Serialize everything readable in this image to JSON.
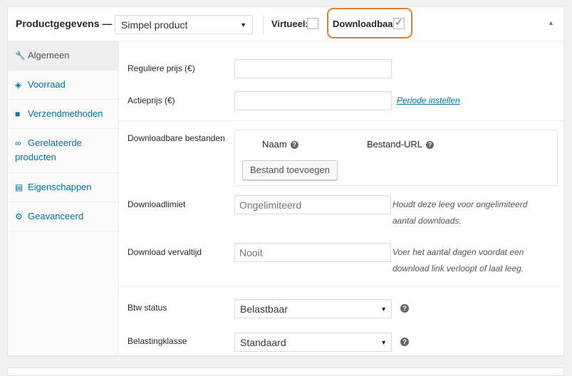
{
  "header": {
    "title": "Productgegevens —",
    "product_type": "Simpel product",
    "virtual_label": "Virtueel:",
    "downloadable_label": "Downloadbaar:",
    "virtual_checked": false,
    "downloadable_checked": true,
    "highlight_color": "#e07f2e"
  },
  "sidebar": {
    "items": [
      {
        "label": "Algemeen",
        "icon": "wrench-icon",
        "active": true
      },
      {
        "label": "Voorraad",
        "icon": "tag-icon",
        "active": false
      },
      {
        "label": "Verzendmethoden",
        "icon": "truck-icon",
        "active": false
      },
      {
        "label": "Gerelateerde producten",
        "label_line1": "Gerelateerde",
        "label_line2": "producten",
        "icon": "link-icon",
        "active": false
      },
      {
        "label": "Eigenschappen",
        "icon": "list-icon",
        "active": false
      },
      {
        "label": "Geavanceerd",
        "icon": "gear-icon",
        "active": false
      }
    ]
  },
  "general": {
    "regular_price_label": "Reguliere prijs (€)",
    "regular_price_value": "",
    "sale_price_label": "Actieprijs (€)",
    "sale_price_value": "",
    "schedule_link": "Periode instellen",
    "downloadable_files_label": "Downloadbare bestanden",
    "col_name": "Naam",
    "col_file_url": "Bestand-URL",
    "add_file_button": "Bestand toevoegen",
    "download_limit_label": "Downloadlimiet",
    "download_limit_placeholder": "Ongelimiteerd",
    "download_limit_hint_line1": "Houdt deze leeg voor ongelimiteerd",
    "download_limit_hint_line2": "aantal downloads.",
    "download_expiry_label": "Download vervaltijd",
    "download_expiry_placeholder": "Nooit",
    "download_expiry_hint_line1": "Voer het aantal dagen voordat een",
    "download_expiry_hint_line2": "download link verloopt of laat leeg.",
    "tax_status_label": "Btw status",
    "tax_status_value": "Belastbaar",
    "tax_class_label": "Belastingklasse",
    "tax_class_value": "Standaard"
  },
  "colors": {
    "link": "#0073aa",
    "accent_ring": "#e07f2e"
  }
}
